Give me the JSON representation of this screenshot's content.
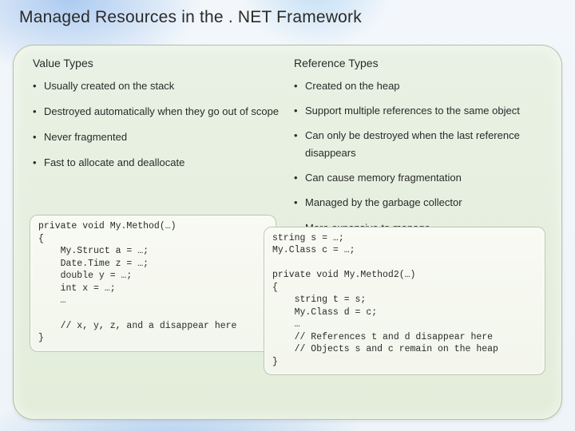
{
  "title": "Managed Resources in the . NET Framework",
  "left": {
    "heading": "Value Types",
    "bullets": [
      "Usually created on the stack",
      "Destroyed automatically when they go out of scope",
      "Never fragmented",
      "Fast to allocate and deallocate"
    ],
    "code": "private void My.Method(…)\n{\n    My.Struct a = …;\n    Date.Time z = …;\n    double y = …;\n    int x = …;\n    …\n\n    // x, y, z, and a disappear here\n}"
  },
  "right": {
    "heading": "Reference Types",
    "bullets": [
      "Created on the heap",
      "Support multiple references to the same object",
      "Can only be destroyed when the last reference disappears",
      "Can cause memory fragmentation",
      "Managed by the garbage collector",
      "More expensive to manage"
    ],
    "code": "string s = …;\nMy.Class c = …;\n\nprivate void My.Method2(…)\n{\n    string t = s;\n    My.Class d = c;\n    …\n    // References t and d disappear here\n    // Objects s and c remain on the heap\n}"
  }
}
